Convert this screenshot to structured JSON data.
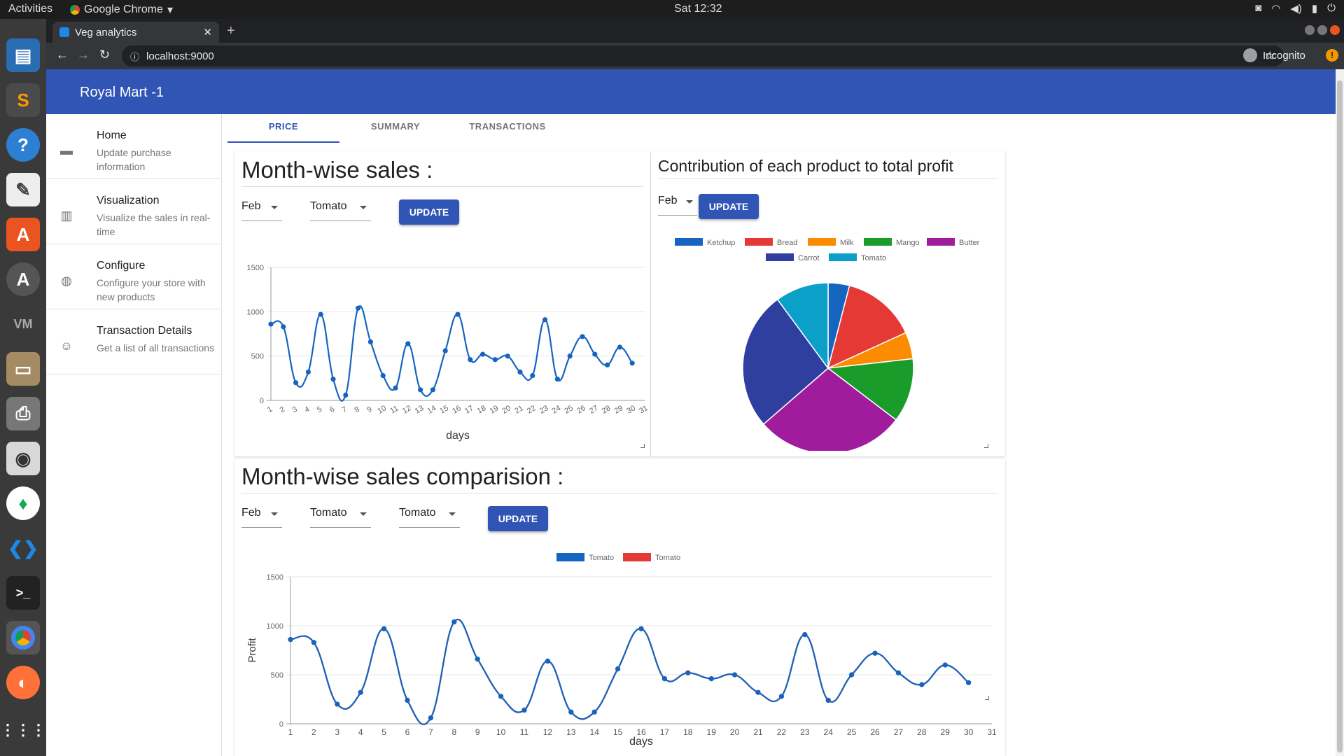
{
  "os": {
    "activities": "Activities",
    "app_name": "Google Chrome",
    "clock": "Sat 12:32"
  },
  "browser": {
    "tab_title": "Veg analytics",
    "url": "localhost:9000",
    "incognito_label": "Incognito"
  },
  "app": {
    "title": "Royal Mart -1",
    "tabs": [
      "PRICE",
      "SUMMARY",
      "TRANSACTIONS"
    ],
    "active_tab": 0
  },
  "sidebar": {
    "items": [
      {
        "title": "Home",
        "desc": "Update purchase information",
        "icon": "comment-icon"
      },
      {
        "title": "Visualization",
        "desc": "Visualize the sales in real-time",
        "icon": "bar-chart-icon"
      },
      {
        "title": "Configure",
        "desc": "Configure your store with new products",
        "icon": "globe-icon"
      },
      {
        "title": "Transaction Details",
        "desc": "Get a list of all transactions",
        "icon": "smiley-icon"
      }
    ]
  },
  "monthwise": {
    "heading": "Month-wise sales :",
    "month": "Feb",
    "product": "Tomato",
    "button": "UPDATE"
  },
  "contribution": {
    "heading": "Contribution of each product to total profit",
    "month": "Feb",
    "button": "UPDATE"
  },
  "comparison": {
    "heading": "Month-wise sales comparision :",
    "month": "Feb",
    "product1": "Tomato",
    "product2": "Tomato",
    "button": "UPDATE"
  },
  "colors": {
    "primary": "#3155b5",
    "line": "#1565c0",
    "series2": "#e53935"
  },
  "chart_data": [
    {
      "type": "line",
      "title": "",
      "xlabel": "days",
      "ylabel": "",
      "ylim": [
        0,
        1500
      ],
      "yticks": [
        0,
        500,
        1000,
        1500
      ],
      "x": [
        1,
        2,
        3,
        4,
        5,
        6,
        7,
        8,
        9,
        10,
        11,
        12,
        13,
        14,
        15,
        16,
        17,
        18,
        19,
        20,
        21,
        22,
        23,
        24,
        25,
        26,
        27,
        28,
        29,
        30,
        31
      ],
      "series": [
        {
          "values": [
            860,
            830,
            200,
            320,
            970,
            240,
            60,
            1040,
            660,
            280,
            140,
            640,
            120,
            120,
            560,
            970,
            460,
            520,
            460,
            500,
            320,
            280,
            910,
            240,
            500,
            720,
            520,
            400,
            600,
            420
          ]
        }
      ]
    },
    {
      "type": "pie",
      "title": "",
      "legend": [
        "Ketchup",
        "Bread",
        "Milk",
        "Mango",
        "Butter",
        "Carrot",
        "Tomato"
      ],
      "colors": [
        "#1565c0",
        "#e53935",
        "#fb8c00",
        "#1a9c2a",
        "#a01c9c",
        "#2f3fa0",
        "#0aa0c8"
      ],
      "values": [
        4,
        14,
        5,
        12,
        28,
        26,
        10
      ]
    },
    {
      "type": "line",
      "title": "",
      "xlabel": "days",
      "ylabel": "Profit",
      "ylim": [
        0,
        1500
      ],
      "yticks": [
        0,
        500,
        1000,
        1500
      ],
      "x": [
        1,
        2,
        3,
        4,
        5,
        6,
        7,
        8,
        9,
        10,
        11,
        12,
        13,
        14,
        15,
        16,
        17,
        18,
        19,
        20,
        21,
        22,
        23,
        24,
        25,
        26,
        27,
        28,
        29,
        30,
        31
      ],
      "series": [
        {
          "name": "Tomato",
          "color": "#1565c0",
          "values": [
            860,
            830,
            200,
            320,
            970,
            240,
            60,
            1040,
            660,
            280,
            140,
            640,
            120,
            120,
            560,
            970,
            460,
            520,
            460,
            500,
            320,
            280,
            910,
            240,
            500,
            720,
            520,
            400,
            600,
            420
          ]
        },
        {
          "name": "Tomato",
          "color": "#e53935",
          "values": [
            860,
            830,
            200,
            320,
            970,
            240,
            60,
            1040,
            660,
            280,
            140,
            640,
            120,
            120,
            560,
            970,
            460,
            520,
            460,
            500,
            320,
            280,
            910,
            240,
            500,
            720,
            520,
            400,
            600,
            420
          ]
        }
      ]
    }
  ]
}
